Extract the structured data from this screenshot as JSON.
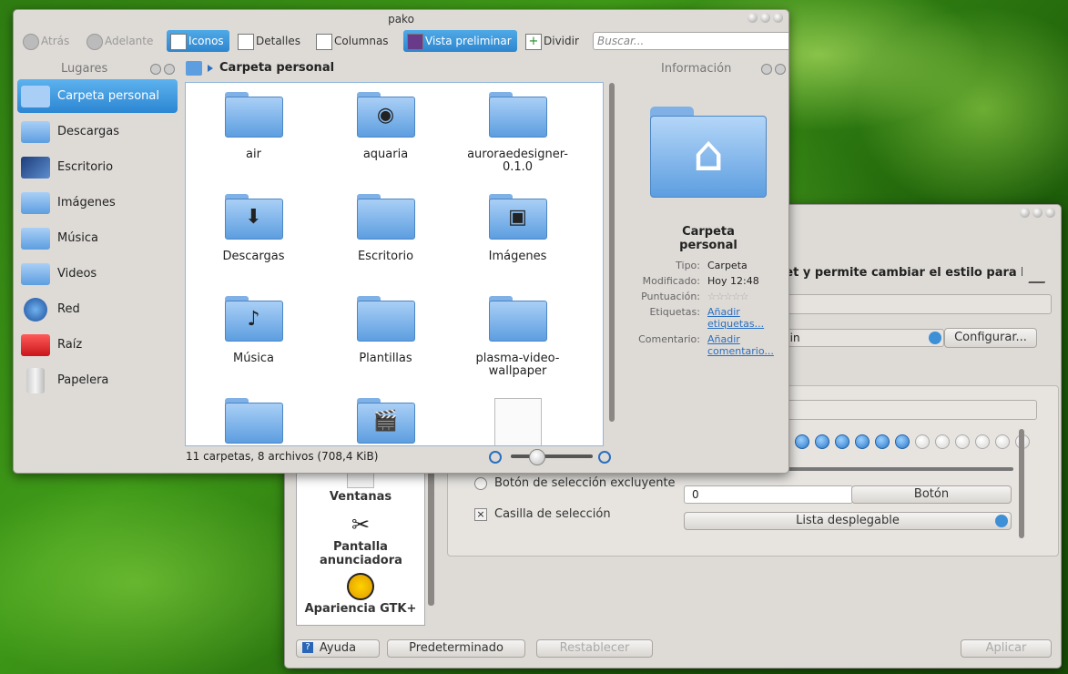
{
  "dolphin": {
    "title": "pako",
    "toolbar": {
      "back": "Atrás",
      "forward": "Adelante",
      "icons": "Iconos",
      "details": "Detalles",
      "columns": "Columnas",
      "preview": "Vista preliminar",
      "split": "Dividir",
      "search_placeholder": "Buscar..."
    },
    "places": {
      "title": "Lugares",
      "items": [
        {
          "label": "Carpeta personal"
        },
        {
          "label": "Descargas"
        },
        {
          "label": "Escritorio"
        },
        {
          "label": "Imágenes"
        },
        {
          "label": "Música"
        },
        {
          "label": "Videos"
        },
        {
          "label": "Red"
        },
        {
          "label": "Raíz"
        },
        {
          "label": "Papelera"
        }
      ]
    },
    "breadcrumb": "Carpeta personal",
    "files": [
      {
        "name": "air"
      },
      {
        "name": "aquaria"
      },
      {
        "name": "auroraedesigner-\n0.1.0"
      },
      {
        "name": "Descargas"
      },
      {
        "name": "Escritorio"
      },
      {
        "name": "Imágenes"
      },
      {
        "name": "Música"
      },
      {
        "name": "Plantillas"
      },
      {
        "name": "plasma-video-\nwallpaper"
      },
      {
        "name": ""
      },
      {
        "name": ""
      },
      {
        "name": ""
      }
    ],
    "status": "11 carpetas, 8 archivos (708,4 KiB)",
    "info": {
      "title": "Información",
      "name": "Carpeta personal",
      "type_label": "Tipo:",
      "type": "Carpeta",
      "modified_label": "Modificado:",
      "modified": "Hoy 12:48",
      "rating_label": "Puntuación:",
      "tags_label": "Etiquetas:",
      "tags_link": "Añadir etiquetas...",
      "comment_label": "Comentario:",
      "comment_link": "Añadir comentario..."
    }
  },
  "settings": {
    "heading": "get y permite cambiar el estilo para l",
    "combo_partial": "pin",
    "configure": "Configurar...",
    "radio": "Botón de selección excluyente",
    "checkbox": "Casilla de selección",
    "spin_value": "0",
    "button": "Botón",
    "dropdown": "Lista desplegable",
    "sidebar": [
      "Ventanas",
      "Pantalla anunciadora",
      "Apariencia GTK+"
    ],
    "footer": {
      "help": "Ayuda",
      "defaults": "Predeterminado",
      "reset": "Restablecer",
      "apply": "Aplicar"
    }
  }
}
